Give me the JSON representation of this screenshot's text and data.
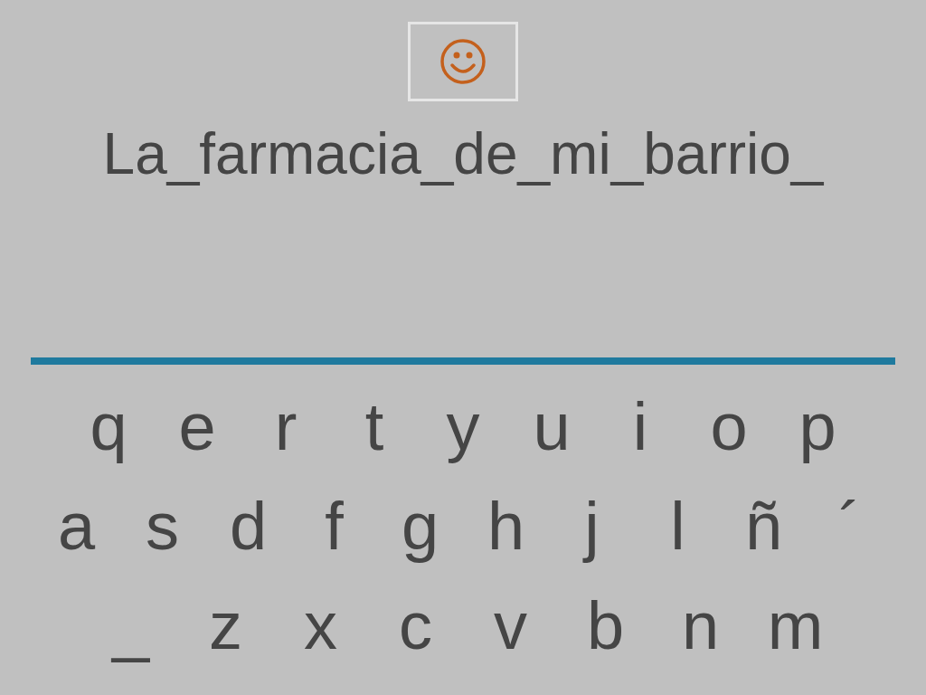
{
  "answer": "La_farmacia_de_mi_barrio_",
  "keyboard": [
    [
      "q",
      "e",
      "r",
      "t",
      "y",
      "u",
      "i",
      "o",
      "p"
    ],
    [
      "a",
      "s",
      "d",
      "f",
      "g",
      "h",
      "j",
      "l",
      "ñ",
      "´"
    ],
    [
      "_",
      "z",
      "x",
      "c",
      "v",
      "b",
      "n",
      "m"
    ]
  ]
}
